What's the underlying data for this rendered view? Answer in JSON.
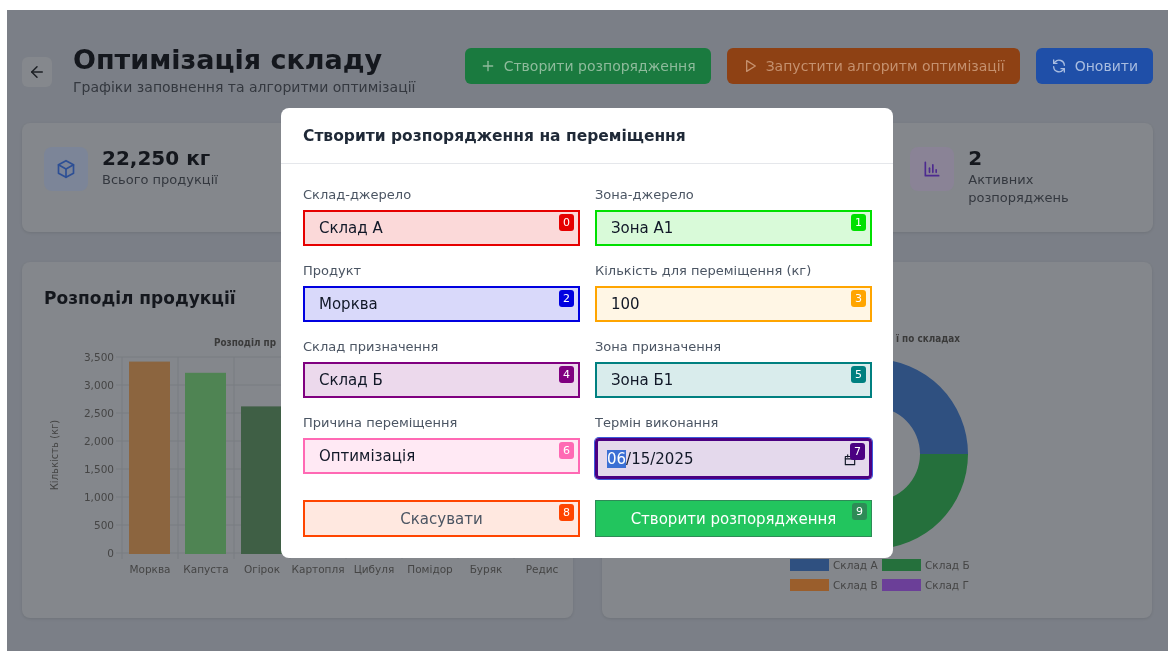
{
  "page": {
    "title": "Оптимізація складу",
    "subtitle": "Графіки заповнення та алгоритми оптимізації",
    "actions": [
      {
        "label": "Створити розпорядження"
      },
      {
        "label": "Запустити алгоритм оптимізації"
      },
      {
        "label": "Оновити"
      }
    ]
  },
  "stats": [
    {
      "value": "22,250 кг",
      "label": "Всього продукції"
    },
    {
      "value": "2",
      "label": "Активних розпоряджень"
    }
  ],
  "bar_card": {
    "title": "Розподіл продукції",
    "chart_data": {
      "type": "bar",
      "title": "Розподіл пр",
      "ylabel": "Кількість (кг)",
      "grid": true,
      "categories": [
        "Морква",
        "Капуста",
        "Огірок",
        "Картопля",
        "Цибуля",
        "Помідор",
        "Буряк",
        "Редис"
      ],
      "values": [
        3400,
        3200,
        2600,
        null,
        null,
        null,
        null,
        null
      ],
      "colors": [
        "#8c653f",
        "#4f8453",
        "#3f5f45",
        null,
        null,
        null,
        null,
        null
      ],
      "ylim": [
        0,
        3500
      ],
      "yticks": [
        {
          "value": 0,
          "label": "0"
        },
        {
          "value": 500,
          "label": "500"
        },
        {
          "value": 1000,
          "label": "1,000"
        },
        {
          "value": 1500,
          "label": "1,500"
        },
        {
          "value": 2000,
          "label": "2,000"
        },
        {
          "value": 2500,
          "label": "2,500"
        },
        {
          "value": 3000,
          "label": "3,000"
        },
        {
          "value": 3500,
          "label": "3,500"
        }
      ]
    }
  },
  "donut_card": {
    "chart_title": "ї по складах",
    "legend": [
      {
        "label": "Склад А",
        "color": "#2f5080"
      },
      {
        "label": "Склад Б",
        "color": "#25703c"
      },
      {
        "label": "Склад В",
        "color": "#9a5e2c"
      },
      {
        "label": "Склад Г",
        "color": "#6b3f98"
      }
    ]
  },
  "modal": {
    "title": "Створити розпорядження на переміщення",
    "fields": [
      {
        "label": "Склад-джерело",
        "value": "Склад А",
        "kind": "select",
        "mark": "0",
        "color": "#e60000",
        "focused": false
      },
      {
        "label": "Зона-джерело",
        "value": "Зона А1",
        "kind": "select",
        "mark": "1",
        "color": "#00e000",
        "focused": false
      },
      {
        "label": "Продукт",
        "value": "Морква",
        "kind": "select",
        "mark": "2",
        "color": "#0000e0",
        "focused": false
      },
      {
        "label": "Кількість для переміщення (кг)",
        "value": "100",
        "kind": "number",
        "mark": "3",
        "color": "#ffa500",
        "focused": false
      },
      {
        "label": "Склад призначення",
        "value": "Склад Б",
        "kind": "select",
        "mark": "4",
        "color": "#800080",
        "focused": false
      },
      {
        "label": "Зона призначення",
        "value": "Зона Б1",
        "kind": "select",
        "mark": "5",
        "color": "#008080",
        "focused": false
      },
      {
        "label": "Причина переміщення",
        "value": "Оптимізація",
        "kind": "select",
        "mark": "6",
        "color": "#ff69b4",
        "focused": false
      },
      {
        "label": "Термін виконання",
        "kind": "date",
        "mark": "7",
        "color": "#4b0082",
        "focused": true,
        "segments": [
          {
            "text": "06",
            "selected": true
          },
          {
            "text": "/15/2025",
            "selected": false
          }
        ]
      }
    ],
    "buttons": [
      {
        "label": "Скасувати",
        "kind": "secondary",
        "mark": "8",
        "color": "#ff4500"
      },
      {
        "label": "Створити розпорядження",
        "kind": "primary",
        "mark": "9",
        "color": "#2e8b57"
      }
    ]
  }
}
